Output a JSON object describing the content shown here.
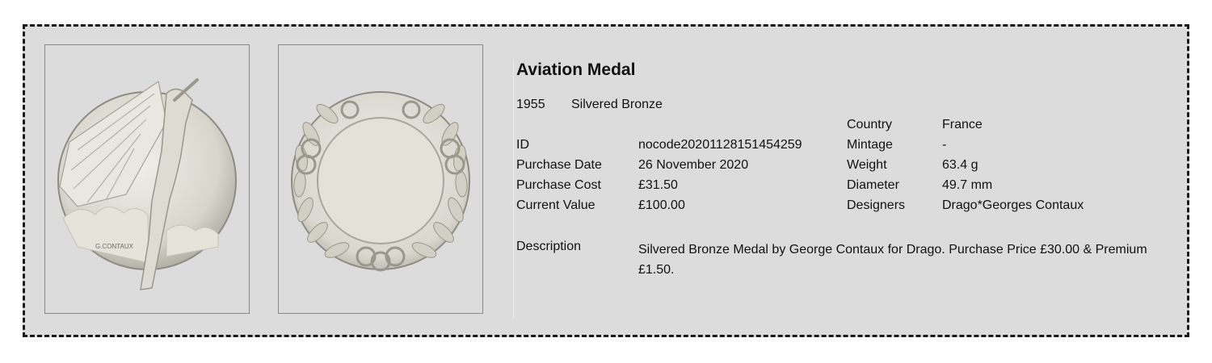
{
  "medal": {
    "title": "Aviation Medal",
    "year": "1955",
    "material": "Silvered Bronze"
  },
  "details_left": [
    {
      "label": "ID",
      "value": "nocode20201128151454259"
    },
    {
      "label": "Purchase Date",
      "value": "26 November 2020"
    },
    {
      "label": "Purchase Cost",
      "value": "£31.50"
    },
    {
      "label": "Current Value",
      "value": "£100.00"
    }
  ],
  "details_right": [
    {
      "label": "Country",
      "value": "France"
    },
    {
      "label": "Mintage",
      "value": "-"
    },
    {
      "label": "Weight",
      "value": "63.4 g"
    },
    {
      "label": "Diameter",
      "value": "49.7 mm"
    },
    {
      "label": "Designers",
      "value": "Drago*Georges Contaux"
    }
  ],
  "description": {
    "label": "Description",
    "text": "Silvered Bronze Medal by George Contaux for Drago.  Purchase Price £30.00 & Premium £1.50."
  },
  "images": {
    "obverse_signature": "G.CONTAUX"
  },
  "colors": {
    "card_background": "#dcdcdc",
    "border": "#1a1a1a",
    "silver_light": "#e8e6df",
    "silver_dark": "#9a978d"
  }
}
